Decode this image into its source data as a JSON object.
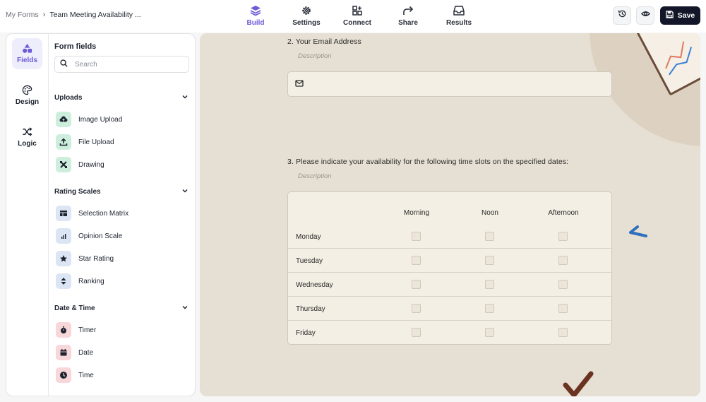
{
  "breadcrumb": {
    "root": "My Forms",
    "separator": "›",
    "current": "Team Meeting Availability ..."
  },
  "nav_tabs": [
    {
      "label": "Build",
      "icon": "layers-icon"
    },
    {
      "label": "Settings",
      "icon": "gear-icon"
    },
    {
      "label": "Connect",
      "icon": "connect-icon"
    },
    {
      "label": "Share",
      "icon": "share-arrow-icon"
    },
    {
      "label": "Results",
      "icon": "inbox-icon"
    }
  ],
  "actions": {
    "history_icon": "history-icon",
    "preview_icon": "eye-icon",
    "save_label": "Save"
  },
  "rail": [
    {
      "label": "Fields",
      "icon": "shapes-icon"
    },
    {
      "label": "Design",
      "icon": "palette-icon"
    },
    {
      "label": "Logic",
      "icon": "shuffle-icon"
    }
  ],
  "fields_panel": {
    "title": "Form fields",
    "search_placeholder": "Search",
    "sections": [
      {
        "title": "Uploads",
        "items": [
          {
            "label": "Image Upload",
            "icon": "cloud-upload-icon"
          },
          {
            "label": "File Upload",
            "icon": "upload-icon"
          },
          {
            "label": "Drawing",
            "icon": "drawing-tools-icon"
          }
        ]
      },
      {
        "title": "Rating Scales",
        "items": [
          {
            "label": "Selection Matrix",
            "icon": "table-icon"
          },
          {
            "label": "Opinion Scale",
            "icon": "bar-chart-icon"
          },
          {
            "label": "Star Rating",
            "icon": "star-icon"
          },
          {
            "label": "Ranking",
            "icon": "sort-icon"
          }
        ]
      },
      {
        "title": "Date & Time",
        "items": [
          {
            "label": "Timer",
            "icon": "stopwatch-icon"
          },
          {
            "label": "Date",
            "icon": "calendar-icon"
          },
          {
            "label": "Time",
            "icon": "clock-icon"
          }
        ]
      }
    ]
  },
  "form": {
    "q2": {
      "label": "2.  Your Email Address",
      "description": "Description"
    },
    "q3": {
      "label": "3.  Please indicate your availability for the following time slots on the specified dates:",
      "description": "Description",
      "columns": [
        "Morning",
        "Noon",
        "Afternoon"
      ],
      "rows": [
        "Monday",
        "Tuesday",
        "Wednesday",
        "Thursday",
        "Friday"
      ]
    }
  },
  "colors": {
    "accent": "#6b5bd6",
    "save_bg": "#121628",
    "canvas_bg": "#e6dfd3",
    "field_bg": "#f4efe4"
  }
}
